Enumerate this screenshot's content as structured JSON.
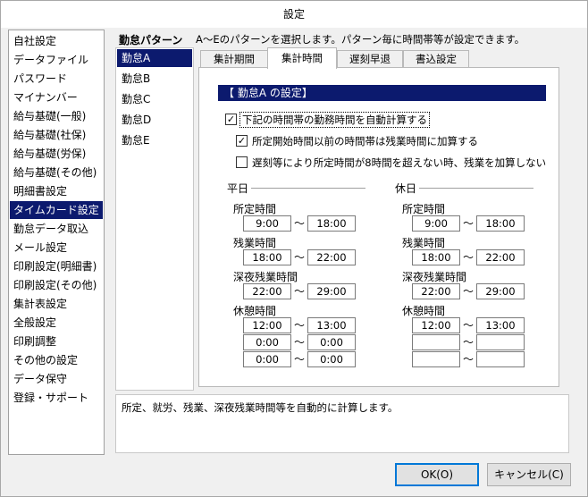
{
  "window": {
    "title": "設定"
  },
  "sidebar": {
    "items": [
      {
        "label": "自社設定"
      },
      {
        "label": "データファイル"
      },
      {
        "label": "パスワード"
      },
      {
        "label": "マイナンバー"
      },
      {
        "label": "給与基礎(一般)"
      },
      {
        "label": "給与基礎(社保)"
      },
      {
        "label": "給与基礎(労保)"
      },
      {
        "label": "給与基礎(その他)"
      },
      {
        "label": "明細書設定"
      },
      {
        "label": "タイムカード設定",
        "selected": true
      },
      {
        "label": "勤怠データ取込"
      },
      {
        "label": "メール設定"
      },
      {
        "label": "印刷設定(明細書)"
      },
      {
        "label": "印刷設定(その他)"
      },
      {
        "label": "集計表設定"
      },
      {
        "label": "全般設定"
      },
      {
        "label": "印刷調整"
      },
      {
        "label": "その他の設定"
      },
      {
        "label": "データ保守"
      },
      {
        "label": "登録・サポート"
      }
    ]
  },
  "header": {
    "title": "勤怠パターン",
    "description": "A～Eのパターンを選択します。パターン毎に時間帯等が設定できます。"
  },
  "patterns": {
    "items": [
      {
        "label": "勤怠A",
        "selected": true
      },
      {
        "label": "勤怠B"
      },
      {
        "label": "勤怠C"
      },
      {
        "label": "勤怠D"
      },
      {
        "label": "勤怠E"
      }
    ]
  },
  "tabs": [
    {
      "label": "集計期間"
    },
    {
      "label": "集計時間",
      "active": true
    },
    {
      "label": "遅刻早退"
    },
    {
      "label": "書込設定"
    }
  ],
  "panel": {
    "heading": "【 勤怠A の設定】",
    "checkboxes": [
      {
        "label": "下記の時間帯の勤務時間を自動計算する",
        "checked": true,
        "mark": "✓"
      },
      {
        "label": "所定開始時間以前の時間帯は残業時間に加算する",
        "checked": true,
        "mark": "✓"
      },
      {
        "label": "遅刻等により所定時間が8時間を超えない時、残業を加算しない",
        "checked": false,
        "mark": ""
      }
    ],
    "tilde": "～",
    "weekday": {
      "title": "平日",
      "scheduled_label": "所定時間",
      "scheduled": [
        "9:00",
        "18:00"
      ],
      "overtime_label": "残業時間",
      "overtime": [
        "18:00",
        "22:00"
      ],
      "night_label": "深夜残業時間",
      "night": [
        "22:00",
        "29:00"
      ],
      "break_label": "休憩時間",
      "breaks": [
        [
          "12:00",
          "13:00"
        ],
        [
          "0:00",
          "0:00"
        ],
        [
          "0:00",
          "0:00"
        ]
      ]
    },
    "holiday": {
      "title": "休日",
      "scheduled_label": "所定時間",
      "scheduled": [
        "9:00",
        "18:00"
      ],
      "overtime_label": "残業時間",
      "overtime": [
        "18:00",
        "22:00"
      ],
      "night_label": "深夜残業時間",
      "night": [
        "22:00",
        "29:00"
      ],
      "break_label": "休憩時間",
      "breaks": [
        [
          "12:00",
          "13:00"
        ],
        [
          "",
          ""
        ],
        [
          "",
          ""
        ]
      ]
    }
  },
  "status": {
    "text": "所定、就労、残業、深夜残業時間等を自動的に計算します。"
  },
  "buttons": {
    "ok": "OK(O)",
    "cancel": "キャンセル(C)"
  },
  "colors": {
    "selection": "#0c1a6e",
    "accent": "#0078d7"
  }
}
